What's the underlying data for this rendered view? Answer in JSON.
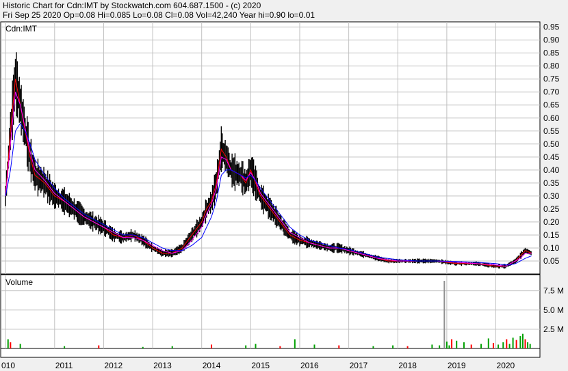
{
  "header": {
    "line1": "Historic Chart for Cdn:IMT by Stockwatch.com 604.687.1500 - (c) 2020",
    "line2": "Fri Sep 25 2020   Op=0.08  Hi=0.085  Lo=0.08  Cl=0.08  Vol=42,240  Year hi=0.90  lo=0.01"
  },
  "colors": {
    "price_bar": "#000000",
    "close_line": "#ff0000",
    "ma_short": "#ff00ff",
    "ma_long": "#0000ff",
    "vol_up": "#00a000",
    "vol_down": "#ff0000",
    "vol_neutral": "#909090",
    "grid": "#c0c0c0"
  },
  "chart_data": [
    {
      "type": "line",
      "title": "Cdn:IMT",
      "panel": "price",
      "y_ticks": [
        "0.95",
        "0.90",
        "0.85",
        "0.80",
        "0.75",
        "0.70",
        "0.65",
        "0.60",
        "0.55",
        "0.50",
        "0.45",
        "0.40",
        "0.35",
        "0.30",
        "0.25",
        "0.20",
        "0.15",
        "0.10",
        "0.05"
      ],
      "ylim": [
        0.0,
        0.97
      ],
      "grid": true,
      "x": [
        2010.0,
        2010.1,
        2010.2,
        2010.3,
        2010.4,
        2010.5,
        2010.6,
        2010.8,
        2011.0,
        2011.2,
        2011.4,
        2011.6,
        2011.8,
        2012.0,
        2012.2,
        2012.4,
        2012.6,
        2012.8,
        2013.0,
        2013.2,
        2013.4,
        2013.6,
        2013.8,
        2014.0,
        2014.1,
        2014.2,
        2014.3,
        2014.4,
        2014.5,
        2014.6,
        2014.8,
        2014.9,
        2015.0,
        2015.1,
        2015.2,
        2015.4,
        2015.6,
        2015.8,
        2016.0,
        2016.2,
        2016.4,
        2016.6,
        2016.8,
        2017.0,
        2017.2,
        2017.4,
        2017.6,
        2017.8,
        2018.0,
        2018.4,
        2018.8,
        2019.2,
        2019.6,
        2020.0,
        2020.2,
        2020.3,
        2020.4,
        2020.5,
        2020.6,
        2020.73
      ],
      "series": [
        {
          "values": [
            0.3,
            0.55,
            0.75,
            0.65,
            0.55,
            0.45,
            0.38,
            0.35,
            0.3,
            0.28,
            0.25,
            0.22,
            0.2,
            0.18,
            0.15,
            0.14,
            0.15,
            0.13,
            0.1,
            0.08,
            0.08,
            0.1,
            0.15,
            0.2,
            0.25,
            0.28,
            0.35,
            0.48,
            0.45,
            0.4,
            0.38,
            0.35,
            0.4,
            0.35,
            0.3,
            0.25,
            0.2,
            0.15,
            0.13,
            0.12,
            0.11,
            0.1,
            0.1,
            0.09,
            0.08,
            0.07,
            0.06,
            0.05,
            0.05,
            0.05,
            0.05,
            0.04,
            0.04,
            0.03,
            0.03,
            0.04,
            0.05,
            0.07,
            0.09,
            0.08
          ]
        },
        {
          "values": [
            0.3,
            0.5,
            0.7,
            0.65,
            0.56,
            0.47,
            0.4,
            0.36,
            0.31,
            0.28,
            0.25,
            0.22,
            0.2,
            0.18,
            0.16,
            0.14,
            0.14,
            0.13,
            0.11,
            0.09,
            0.08,
            0.09,
            0.13,
            0.18,
            0.23,
            0.27,
            0.33,
            0.45,
            0.44,
            0.4,
            0.38,
            0.36,
            0.39,
            0.36,
            0.31,
            0.26,
            0.21,
            0.16,
            0.14,
            0.12,
            0.11,
            0.1,
            0.1,
            0.09,
            0.08,
            0.07,
            0.06,
            0.055,
            0.05,
            0.05,
            0.05,
            0.045,
            0.04,
            0.035,
            0.03,
            0.04,
            0.05,
            0.06,
            0.08,
            0.08
          ]
        },
        {
          "values": [
            0.3,
            0.4,
            0.55,
            0.58,
            0.55,
            0.5,
            0.44,
            0.38,
            0.33,
            0.29,
            0.26,
            0.23,
            0.21,
            0.19,
            0.17,
            0.15,
            0.15,
            0.14,
            0.12,
            0.1,
            0.09,
            0.09,
            0.11,
            0.14,
            0.18,
            0.22,
            0.28,
            0.38,
            0.4,
            0.4,
            0.38,
            0.37,
            0.38,
            0.36,
            0.33,
            0.28,
            0.23,
            0.18,
            0.15,
            0.13,
            0.12,
            0.11,
            0.1,
            0.095,
            0.085,
            0.075,
            0.065,
            0.06,
            0.055,
            0.05,
            0.05,
            0.048,
            0.045,
            0.04,
            0.035,
            0.035,
            0.04,
            0.05,
            0.06,
            0.07
          ]
        }
      ]
    },
    {
      "type": "bar",
      "title": "Volume",
      "panel": "volume",
      "y_ticks": [
        "7.5 M",
        "5.0 M",
        "2.5 M"
      ],
      "ylim": [
        0,
        9.6
      ],
      "x_ticks": [
        "010",
        "2011",
        "2012",
        "2013",
        "2014",
        "2015",
        "2016",
        "2017",
        "2018",
        "2019",
        "2020"
      ],
      "x": [
        2010.05,
        2010.1,
        2010.3,
        2011.2,
        2011.9,
        2012.8,
        2013.4,
        2014.2,
        2014.9,
        2015.1,
        2015.6,
        2015.9,
        2016.3,
        2016.8,
        2017.5,
        2017.9,
        2018.2,
        2018.7,
        2018.85,
        2018.95,
        2019.0,
        2019.05,
        2019.1,
        2019.2,
        2019.35,
        2019.5,
        2019.7,
        2019.85,
        2019.95,
        2020.05,
        2020.15,
        2020.22,
        2020.28,
        2020.35,
        2020.42,
        2020.5,
        2020.55,
        2020.6,
        2020.65,
        2020.7
      ],
      "values": [
        1.2,
        0.8,
        0.6,
        0.3,
        0.4,
        0.2,
        0.3,
        0.5,
        0.4,
        0.6,
        0.3,
        1.2,
        0.5,
        0.4,
        0.3,
        0.4,
        0.3,
        0.5,
        0.4,
        8.8,
        0.9,
        0.4,
        1.2,
        1.0,
        0.8,
        0.5,
        0.6,
        1.3,
        0.7,
        0.5,
        0.8,
        1.2,
        0.6,
        1.4,
        1.1,
        1.6,
        1.9,
        1.2,
        0.8,
        0.6
      ]
    }
  ]
}
